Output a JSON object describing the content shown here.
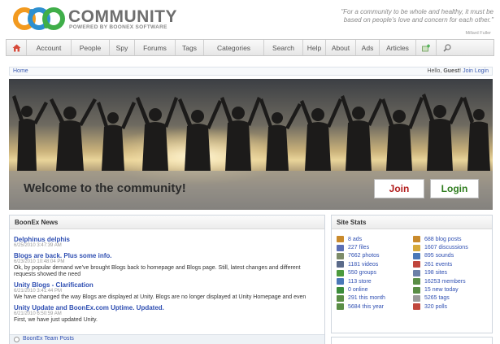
{
  "brand": {
    "title": "COMMUNITY",
    "subtitle": "POWERED BY BOONEX SOFTWARE",
    "quote": "\"For a community to be whole and healthy, it must be based on people's love and concern for each other.\"",
    "quote_author": "Millard Fuller",
    "colors": {
      "orange": "#f29a1f",
      "blue": "#2d8fd0",
      "green": "#3fae49"
    }
  },
  "nav": {
    "items": [
      {
        "label": "",
        "icon": "home-icon"
      },
      {
        "label": "Account"
      },
      {
        "label": "People"
      },
      {
        "label": "Spy"
      },
      {
        "label": "Forums"
      },
      {
        "label": "Tags"
      },
      {
        "label": "Categories"
      },
      {
        "label": "Search"
      },
      {
        "label": "Help"
      },
      {
        "label": "About"
      },
      {
        "label": "Ads"
      },
      {
        "label": "Articles"
      },
      {
        "label": "",
        "icon": "add-icon"
      },
      {
        "label": "",
        "icon": "search-icon"
      }
    ]
  },
  "breadcrumb": {
    "home": "Home",
    "greeting": "Hello, ",
    "user": "Guest",
    "separator": "! ",
    "join": "Join",
    "login": "Login"
  },
  "hero": {
    "welcome": "Welcome to the community!",
    "join_label": "Join",
    "login_label": "Login"
  },
  "news": {
    "header": "BoonEx News",
    "items": [
      {
        "title": "Delphinus delphis",
        "date": "6/25/2010 3:47:39 AM",
        "body": ""
      },
      {
        "title": "Blogs are back. Plus some info.",
        "date": "6/23/2010 10:48:04 PM",
        "body": "Ok, by popular demand we've brought Blogs back to homepage and Blogs page. Still, latest changes and different requests showed the need"
      },
      {
        "title": "Unity Blogs - Clarification",
        "date": "6/21/2010 3:41:44 PM",
        "body": "We have changed the way Blogs are displayed at Unity. Blogs are no longer displayed at Unity Homepage and even"
      },
      {
        "title": "Unity Update and BoonEx.com Uptime. Updated.",
        "date": "6/21/2010 6:50:59 AM",
        "body": "First, we have just updated Unity."
      }
    ],
    "footer_link": "BoonEx Team Posts"
  },
  "stats": {
    "header": "Site Stats",
    "left": [
      {
        "label": "8 ads",
        "icon": "ads-icon",
        "color": "#c98a2c"
      },
      {
        "label": "227 files",
        "icon": "files-icon",
        "color": "#5b6fb5"
      },
      {
        "label": "7662 photos",
        "icon": "photos-icon",
        "color": "#7d8c6a"
      },
      {
        "label": "1181 videos",
        "icon": "videos-icon",
        "color": "#5a6a8a"
      },
      {
        "label": "550 groups",
        "icon": "groups-icon",
        "color": "#4c9a3c"
      },
      {
        "label": "113 store",
        "icon": "store-icon",
        "color": "#4a78b8"
      },
      {
        "label": "0 online",
        "icon": "online-icon",
        "color": "#3b8d3b"
      },
      {
        "label": "291 this month",
        "icon": "month-icon",
        "color": "#5a8e46"
      },
      {
        "label": "5684 this year",
        "icon": "year-icon",
        "color": "#5a8e46"
      }
    ],
    "right": [
      {
        "label": "688 blog posts",
        "icon": "blog-icon",
        "color": "#c98a2c"
      },
      {
        "label": "1607 discussions",
        "icon": "discussions-icon",
        "color": "#d6a93a"
      },
      {
        "label": "895 sounds",
        "icon": "sounds-icon",
        "color": "#4a78b8"
      },
      {
        "label": "261 events",
        "icon": "events-icon",
        "color": "#c0463c"
      },
      {
        "label": "198 sites",
        "icon": "sites-icon",
        "color": "#6b7fa8"
      },
      {
        "label": "16253 members",
        "icon": "members-icon",
        "color": "#5a8e46"
      },
      {
        "label": "15 new today",
        "icon": "new-today-icon",
        "color": "#5a8e46"
      },
      {
        "label": "5265 tags",
        "icon": "tags-icon",
        "color": "#9a9a9a"
      },
      {
        "label": "320 polls",
        "icon": "polls-icon",
        "color": "#c0463c"
      }
    ]
  }
}
